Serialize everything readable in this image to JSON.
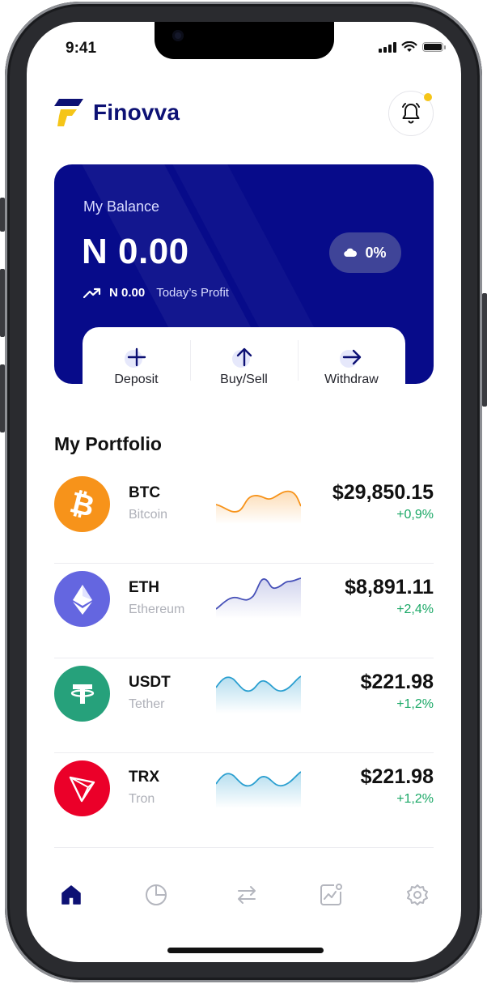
{
  "status_bar": {
    "time": "9:41"
  },
  "header": {
    "brand_name": "Finovva"
  },
  "balance": {
    "label": "My Balance",
    "amount": "N 0.00",
    "change_pill": "0%",
    "profit_value": "N 0.00",
    "profit_label": "Today’s Profit"
  },
  "actions": [
    {
      "label": "Deposit",
      "icon": "plus-icon"
    },
    {
      "label": "Buy/Sell",
      "icon": "arrow-up-icon"
    },
    {
      "label": "Withdraw",
      "icon": "arrow-right-icon"
    }
  ],
  "portfolio": {
    "title": "My Portfolio",
    "items": [
      {
        "symbol": "BTC",
        "name": "Bitcoin",
        "price": "$29,850.15",
        "change": "+0,9%",
        "color": "#f7931a",
        "icon": "bitcoin-icon"
      },
      {
        "symbol": "ETH",
        "name": "Ethereum",
        "price": "$8,891.11",
        "change": "+2,4%",
        "color": "#6466e0",
        "icon": "ethereum-icon"
      },
      {
        "symbol": "USDT",
        "name": "Tether",
        "price": "$221.98",
        "change": "+1,2%",
        "color": "#26a17b",
        "icon": "tether-icon"
      },
      {
        "symbol": "TRX",
        "name": "Tron",
        "price": "$221.98",
        "change": "+1,2%",
        "color": "#eb0029",
        "icon": "tron-icon"
      }
    ]
  },
  "tabbar": [
    "home-icon",
    "pie-chart-icon",
    "swap-icon",
    "analytics-icon",
    "settings-icon"
  ],
  "colors": {
    "brand_navy": "#070b8a",
    "accent_yellow": "#f5c518",
    "positive_green": "#1aa866"
  }
}
